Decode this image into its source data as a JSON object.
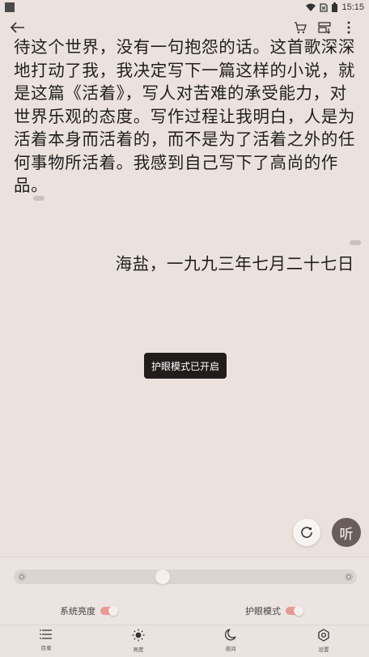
{
  "status_bar": {
    "time": "15:15"
  },
  "content": {
    "paragraph_lines": [
      "待这个世界，没有一句抱怨的话。这首歌深深",
      "地打动了我，我决定写下一篇这样的小说，就",
      "是这篇《活着》，写人对苦难的承受能力，对",
      "世界乐观的态度。写作过程让我明白，人是为",
      "活着本身而活着的，而不是为了活着之外的任",
      "何事物所活着。我感到自己写下了高尚的作",
      "品。"
    ],
    "signature": "海盐，一九九三年七月二十七日"
  },
  "toast": {
    "text": "护眼模式已开启"
  },
  "fab": {
    "listen_label": "听"
  },
  "panel": {
    "brightness_level": 0.43,
    "system_brightness_label": "系统亮度",
    "eye_mode_label": "护眼模式"
  },
  "bottom_nav": {
    "items": [
      {
        "label": "目录",
        "icon": "menu-icon"
      },
      {
        "label": "亮度",
        "icon": "brightness-icon"
      },
      {
        "label": "夜间",
        "icon": "moon-icon"
      },
      {
        "label": "设置",
        "icon": "settings-icon"
      }
    ]
  },
  "colors": {
    "background": "#ece2dd",
    "toggle_on": "#e89a92",
    "toast_bg": "#221d1c",
    "listen_fab": "#6a5e5b"
  }
}
